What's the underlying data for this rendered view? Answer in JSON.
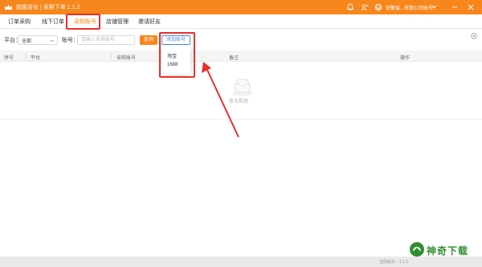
{
  "app": {
    "title": "超级店长 | 采购下单 1.1.2",
    "user": "安徽省...有限公司账号"
  },
  "tabs": [
    {
      "label": "订单采购"
    },
    {
      "label": "线下订单"
    },
    {
      "label": "采购账号"
    },
    {
      "label": "店铺管理"
    },
    {
      "label": "邀请好友"
    }
  ],
  "filter": {
    "platform_label": "平台：",
    "platform_value": "全部",
    "account_label": "账号：",
    "account_placeholder": "请输入采购账号",
    "search_button": "查询",
    "add_button": "添加账号"
  },
  "dropdown": {
    "items": [
      "淘宝",
      "1688"
    ]
  },
  "table": {
    "columns": [
      "序号",
      "平台",
      "采购账号",
      "备注",
      "操作"
    ],
    "empty_text": "暂无数据"
  },
  "status": {
    "version_text": "当前版本：1.1.2"
  },
  "watermark": {
    "text": "神奇下载"
  },
  "colors": {
    "accent": "#f7861c",
    "link": "#4a90e2",
    "highlight": "#e8312a",
    "annotation_arrow": "#e8312a"
  },
  "icons": [
    "crown-logo-icon",
    "bell-icon",
    "user-switch-icon",
    "avatar-icon",
    "chevron-down-icon",
    "minimize-icon",
    "close-icon",
    "settings-icon",
    "empty-box-icon"
  ]
}
